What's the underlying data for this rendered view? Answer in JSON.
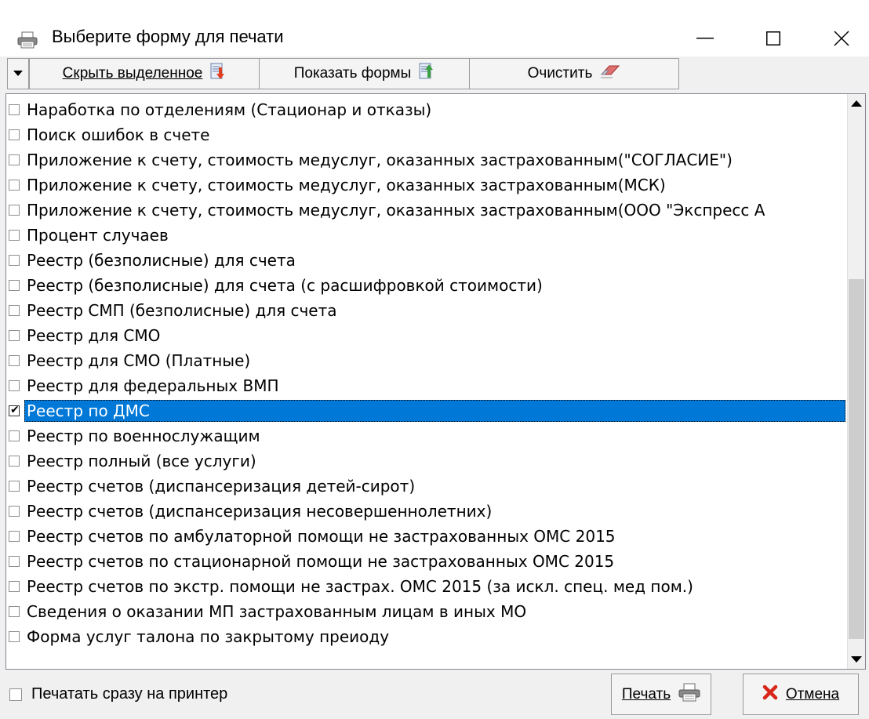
{
  "window": {
    "title": "Выберите форму для печати",
    "minimize_glyph": "—",
    "maximize_glyph": "☐",
    "close_glyph": "✕"
  },
  "toolbar": {
    "hide_selected_label": "Скрыть выделенное",
    "show_forms_label": "Показать формы",
    "clear_label": "Очистить"
  },
  "forms": [
    {
      "label": "Наработка по отделениям (Стационар и отказы)",
      "checked": false
    },
    {
      "label": "Поиск ошибок в счете",
      "checked": false
    },
    {
      "label": "Приложение к счету, стоимость медуслуг, оказанных застрахованным(\"СОГЛАСИЕ\")",
      "checked": false
    },
    {
      "label": "Приложение к счету, стоимость медуслуг, оказанных застрахованным(МСК)",
      "checked": false
    },
    {
      "label": "Приложение к счету, стоимость медуслуг, оказанных застрахованным(ООО \"Экспресс А",
      "checked": false
    },
    {
      "label": "Процент случаев",
      "checked": false
    },
    {
      "label": "Реестр (безполисные) для счета",
      "checked": false
    },
    {
      "label": "Реестр (безполисные) для счета (с расшифровкой стоимости)",
      "checked": false
    },
    {
      "label": "Реестр СМП (безполисные) для счета",
      "checked": false
    },
    {
      "label": "Реестр для СМО",
      "checked": false
    },
    {
      "label": "Реестр для СМО (Платные)",
      "checked": false
    },
    {
      "label": "Реестр для федеральных ВМП",
      "checked": false
    },
    {
      "label": "Реестр по ДМС",
      "checked": true
    },
    {
      "label": "Реестр по военнослужащим",
      "checked": false
    },
    {
      "label": "Реестр полный (все услуги)",
      "checked": false
    },
    {
      "label": "Реестр счетов (диспансеризация детей-сирот)",
      "checked": false
    },
    {
      "label": "Реестр счетов (диспансеризация несовершеннолетних)",
      "checked": false
    },
    {
      "label": "Реестр счетов по амбулаторной помощи не застрахованных ОМС 2015",
      "checked": false
    },
    {
      "label": "Реестр счетов по стационарной помощи не застрахованных ОМС 2015",
      "checked": false
    },
    {
      "label": "Реестр счетов по экстр. помощи не застрах. ОМС 2015 (за искл. спец. мед пом.)",
      "checked": false
    },
    {
      "label": "Сведения о оказании МП застрахованным лицам в иных МО",
      "checked": false
    },
    {
      "label": "Форма услуг талона по закрытому преиоду",
      "checked": false
    }
  ],
  "scrollbar": {
    "thumb_start_fraction": 0.31,
    "thumb_size_fraction": 0.67
  },
  "footer": {
    "print_directly_label": "Печатать сразу на принтер",
    "print_directly_checked": false,
    "print_label": "Печать",
    "cancel_label": "Отмена"
  }
}
